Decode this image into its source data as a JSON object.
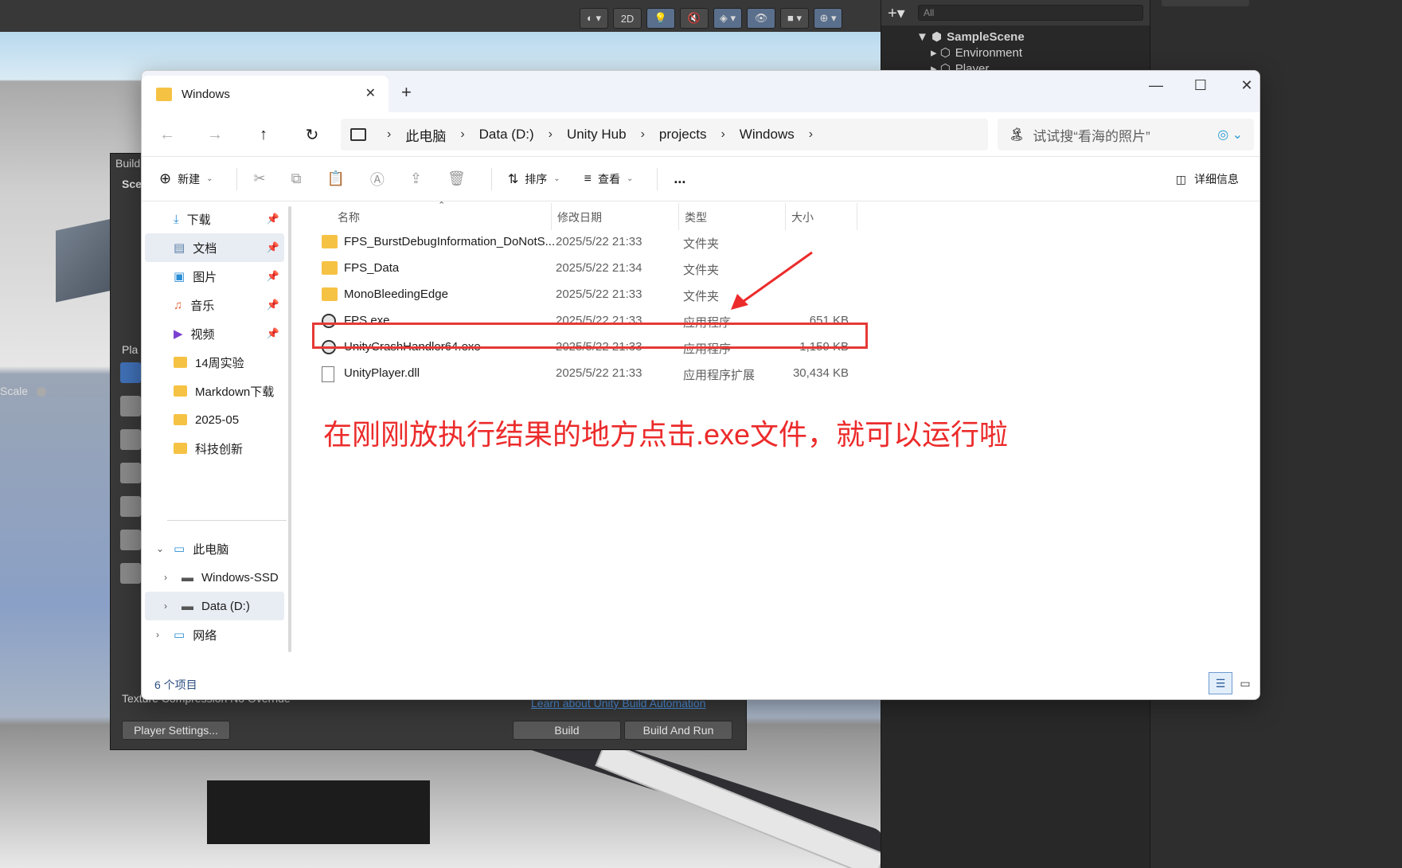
{
  "unity": {
    "toolbar_2d": "2D",
    "hierarchy": {
      "search_placeholder": "All",
      "scene": "SampleScene",
      "children": [
        "Environment",
        "Player"
      ]
    },
    "build": {
      "title": "Build",
      "scenes_label": "Sce",
      "platform_label": "Pla",
      "scale_label": "Scale",
      "texture_compression_label": "Texture Compression",
      "texture_compression_value": "No Override",
      "learn_link": "Learn about Unity Build Automation",
      "player_settings_btn": "Player Settings...",
      "build_btn": "Build",
      "build_and_run_btn": "Build And Run"
    }
  },
  "explorer": {
    "tab_title": "Windows",
    "breadcrumb": [
      "此电脑",
      "Data (D:)",
      "Unity Hub",
      "projects",
      "Windows"
    ],
    "search_placeholder": "试试搜“看海的照片”",
    "commands": {
      "new": "新建",
      "sort": "排序",
      "view": "查看",
      "more": "...",
      "details": "详细信息"
    },
    "sidebar": {
      "quick_access": [
        {
          "label": "下载",
          "pinned": true
        },
        {
          "label": "文档",
          "pinned": true
        },
        {
          "label": "图片",
          "pinned": true
        },
        {
          "label": "音乐",
          "pinned": true
        },
        {
          "label": "视频",
          "pinned": true
        },
        {
          "label": "14周实验",
          "pinned": false
        },
        {
          "label": "Markdown下载",
          "pinned": false
        },
        {
          "label": "2025-05",
          "pinned": false
        },
        {
          "label": "科技创新",
          "pinned": false
        }
      ],
      "this_pc": "此电脑",
      "drives": [
        "Windows-SSD",
        "Data (D:)"
      ],
      "network": "网络"
    },
    "columns": [
      "名称",
      "修改日期",
      "类型",
      "大小"
    ],
    "files": [
      {
        "name": "FPS_BurstDebugInformation_DoNotS...",
        "date": "2025/5/22 21:33",
        "type": "文件夹",
        "size": "",
        "icon": "folder-icon"
      },
      {
        "name": "FPS_Data",
        "date": "2025/5/22 21:34",
        "type": "文件夹",
        "size": "",
        "icon": "folder-icon"
      },
      {
        "name": "MonoBleedingEdge",
        "date": "2025/5/22 21:33",
        "type": "文件夹",
        "size": "",
        "icon": "folder-icon"
      },
      {
        "name": "FPS.exe",
        "date": "2025/5/22 21:33",
        "type": "应用程序",
        "size": "651 KB",
        "icon": "unity-exe-icon"
      },
      {
        "name": "UnityCrashHandler64.exe",
        "date": "2025/5/22 21:33",
        "type": "应用程序",
        "size": "1,159 KB",
        "icon": "unity-exe-icon"
      },
      {
        "name": "UnityPlayer.dll",
        "date": "2025/5/22 21:33",
        "type": "应用程序扩展",
        "size": "30,434 KB",
        "icon": "dll-icon"
      }
    ],
    "annotation": "在刚刚放执行结果的地方点击.exe文件，就可以运行啦",
    "annotation_color": "#ec2b2b",
    "status": "6 个项目"
  }
}
